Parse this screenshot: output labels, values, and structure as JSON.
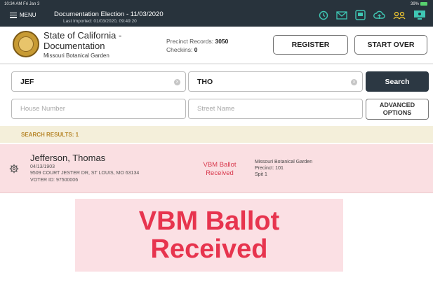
{
  "status_bar": {
    "left": "10:34 AM  Fri Jan 3",
    "right": "39%"
  },
  "app_bar": {
    "menu_label": "MENU",
    "election_title": "Documentation Election - 11/03/2020",
    "last_imported": "Last Imported: 01/03/2020, 09:49:20",
    "icons": [
      "history-icon",
      "mail-icon",
      "printer-icon",
      "cloud-sync-icon",
      "users-icon",
      "monitor-icon"
    ]
  },
  "header": {
    "state_title": "State of California - Documentation",
    "location": "Missouri Botanical Garden",
    "precinct_records_label": "Precinct Records:",
    "precinct_records_value": "3050",
    "checkins_label": "Checkins:",
    "checkins_value": "0",
    "register_label": "REGISTER",
    "start_over_label": "START OVER"
  },
  "search": {
    "first_name_value": "JEF",
    "last_name_value": "THO",
    "house_number_placeholder": "House Number",
    "street_name_placeholder": "Street Name",
    "search_label": "Search",
    "advanced_label_line1": "ADVANCED",
    "advanced_label_line2": "OPTIONS"
  },
  "results": {
    "label": "SEARCH RESULTS: 1",
    "items": [
      {
        "name": "Jefferson, Thomas",
        "dob": "04/13/1903",
        "address": "9509 COURT JESTER DR, ST LOUIS, MO 63134",
        "voter_id": "VOTER ID: 97500006",
        "status_line1": "VBM Ballot",
        "status_line2": "Received",
        "site_name": "Missouri Botanical Garden",
        "precinct": "Precinct: 101",
        "split": "Spit 1"
      }
    ]
  },
  "callout": {
    "line1": "VBM Ballot",
    "line2": "Received"
  },
  "colors": {
    "app_bar": "#28333c",
    "accent_teal": "#3fc7b4",
    "accent_yellow": "#f2c832",
    "status_red": "#e7344e",
    "row_background": "#fadfe2",
    "results_bar": "#f4efda"
  }
}
